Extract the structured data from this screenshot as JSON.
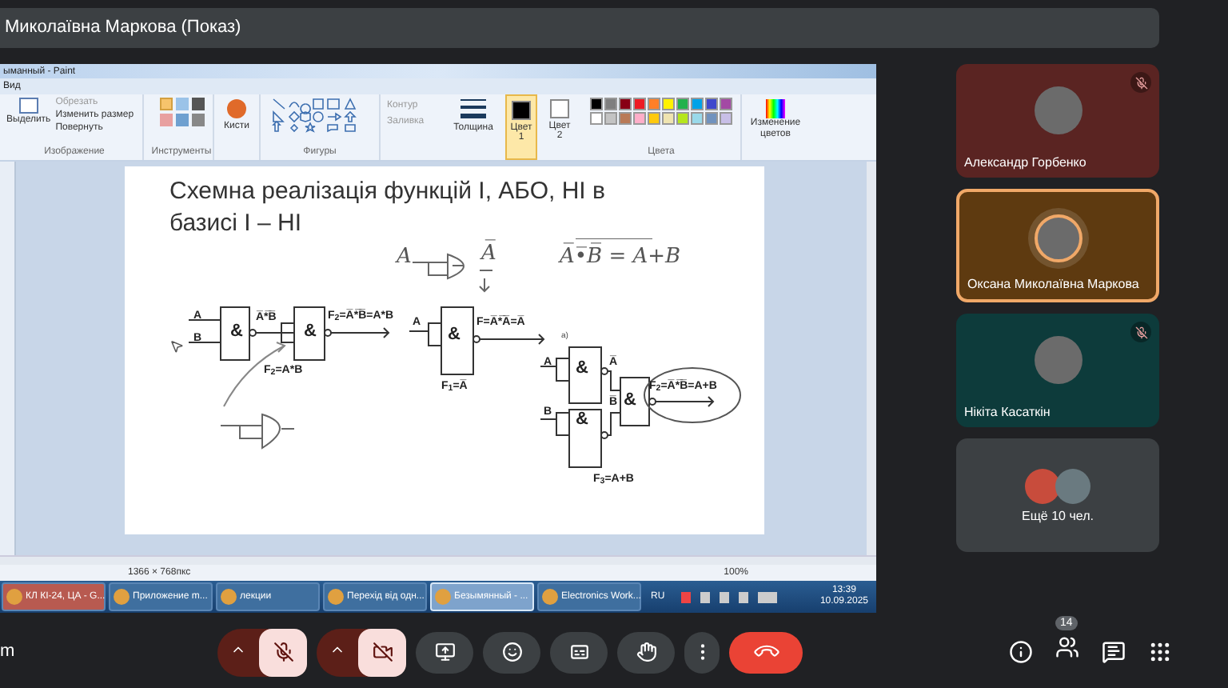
{
  "presenter_bar": {
    "title": "Миколаївна Маркова (Показ)"
  },
  "paint": {
    "title": "ыманный - Paint",
    "menu": [
      "Вид"
    ],
    "ribbon": {
      "select": "Выделить",
      "crop": "Обрезать",
      "resize": "Изменить размер",
      "rotate": "Повернуть",
      "image_label": "Изображение",
      "tools_label": "Инструменты",
      "brushes": "Кисти",
      "shapes_label": "Фигуры",
      "outline": "Контур",
      "fill": "Заливка",
      "size": "Толщина",
      "color_slots": [
        {
          "label": "Цвет",
          "number": "1",
          "selected": true,
          "color": "#000000"
        },
        {
          "label": "Цвет",
          "number": "2",
          "selected": false,
          "color": "#ffffff"
        }
      ],
      "colors_label": "Цвета",
      "edit_colors": "Изменение цветов",
      "palette": [
        {
          "color": "#000000"
        },
        {
          "color": "#7f7f7f"
        },
        {
          "color": "#880015"
        },
        {
          "color": "#ed1c24"
        },
        {
          "color": "#ff7f27"
        },
        {
          "color": "#fff200"
        },
        {
          "color": "#22b14c"
        },
        {
          "color": "#00a2e8"
        },
        {
          "color": "#3f48cc"
        },
        {
          "color": "#a349a4"
        },
        {
          "color": "#ffffff"
        },
        {
          "color": "#c3c3c3"
        },
        {
          "color": "#b97a57"
        },
        {
          "color": "#ffaec9"
        },
        {
          "color": "#ffc90e"
        },
        {
          "color": "#efe4b0"
        },
        {
          "color": "#b5e61d"
        },
        {
          "color": "#99d9ea"
        },
        {
          "color": "#7092be"
        },
        {
          "color": "#c8bfe7"
        }
      ]
    },
    "slide": {
      "title": "Схемна реалізація функцій І, АБО, НІ в базисі І – НІ",
      "labels": [
        {
          "kind": "print",
          "text": "A"
        },
        {
          "kind": "print",
          "text": "B"
        },
        {
          "kind": "gate",
          "text": "&"
        },
        {
          "kind": "print",
          "text": "A̅*̅B̅"
        },
        {
          "kind": "gate",
          "text": "&"
        },
        {
          "kind": "print",
          "text": "F$_{2}$=A̅*̅B̅=A*B"
        },
        {
          "kind": "print",
          "text": "F$_{2}$=A*B"
        },
        {
          "kind": "print",
          "text": "A"
        },
        {
          "kind": "gate",
          "text": "&"
        },
        {
          "kind": "print",
          "text": "F=A̅*̅A̅=A̅"
        },
        {
          "kind": "print",
          "text": "F$_{1}$=A̅"
        },
        {
          "kind": "small",
          "text": "а)"
        },
        {
          "kind": "print",
          "text": "A"
        },
        {
          "kind": "gate",
          "text": "&"
        },
        {
          "kind": "print",
          "text": "A̅"
        },
        {
          "kind": "gate",
          "text": "&"
        },
        {
          "kind": "print",
          "text": "B"
        },
        {
          "kind": "gate",
          "text": "&"
        },
        {
          "kind": "print",
          "text": "B̅"
        },
        {
          "kind": "print",
          "text": "F$_{2}$=A̅*̅B̅=A+B"
        },
        {
          "kind": "print",
          "text": "F$_{3}$=A+B"
        },
        {
          "kind": "hand",
          "text": "A"
        },
        {
          "kind": "hand",
          "text": "A̅"
        },
        {
          "kind": "hand",
          "text": "A̅•̅B̅ = A+B"
        }
      ]
    },
    "status": {
      "size": "1366 × 768пкс",
      "zoom": "100%"
    }
  },
  "taskbar": {
    "items": [
      {
        "label": "КЛ КІ-24, ЦА - G...",
        "selected": false,
        "alert": true
      },
      {
        "label": "Приложение m...",
        "selected": false,
        "alert": false
      },
      {
        "label": "лекции",
        "selected": false,
        "alert": false
      },
      {
        "label": "Перехід від одн...",
        "selected": false,
        "alert": false
      },
      {
        "label": "Безымянный - ...",
        "selected": true,
        "alert": false
      },
      {
        "label": "Electronics Work...",
        "selected": false,
        "alert": false
      }
    ],
    "language": "RU",
    "time": "13:39",
    "date": "10.09.2025"
  },
  "participants": [
    {
      "kind": "person",
      "name": "Александр Горбенко",
      "muted": true,
      "speaking": false,
      "color": "#5a2422"
    },
    {
      "kind": "person",
      "name": "Оксана Миколаївна Маркова",
      "muted": false,
      "speaking": true,
      "color": "#5e3a10"
    },
    {
      "kind": "person",
      "name": "Нікіта Касаткін",
      "muted": true,
      "speaking": false,
      "color": "#0d3b3b"
    },
    {
      "kind": "more",
      "name": "Ещё 10 чел.",
      "muted": false,
      "speaking": false,
      "color": "#3c4043"
    }
  ],
  "meeting": {
    "name": "m",
    "mic_on": false,
    "camera_on": false,
    "people_count": "14"
  }
}
